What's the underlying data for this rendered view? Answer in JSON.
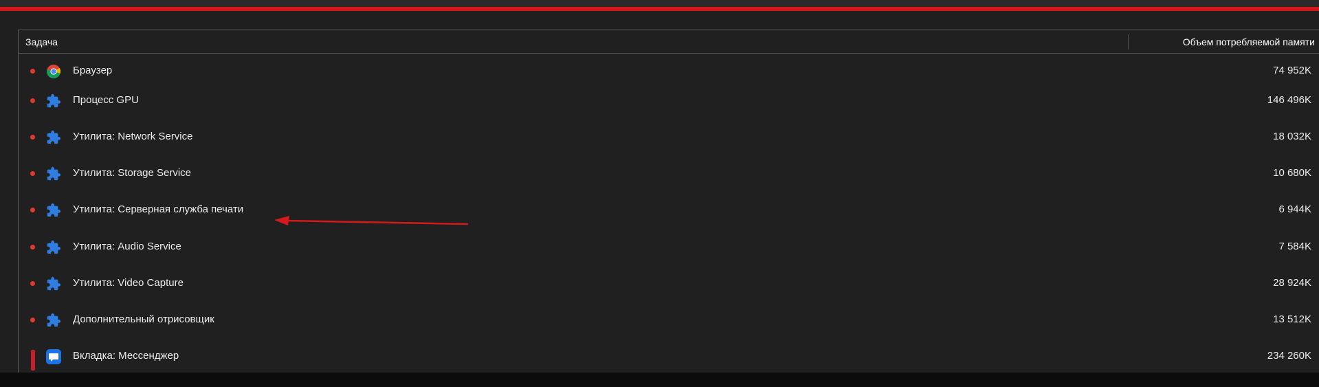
{
  "table": {
    "headers": {
      "task": "Задача",
      "memory": "Объем потребляемой памяти"
    },
    "rows": [
      {
        "icon": "chrome-icon",
        "name": "Браузер",
        "memory": "74 952K"
      },
      {
        "icon": "extension-puzzle-icon",
        "name": "Процесс GPU",
        "memory": "146 496K"
      },
      {
        "icon": "extension-puzzle-icon",
        "name": "Утилита: Network Service",
        "memory": "18 032K"
      },
      {
        "icon": "extension-puzzle-icon",
        "name": "Утилита: Storage Service",
        "memory": "10 680K"
      },
      {
        "icon": "extension-puzzle-icon",
        "name": "Утилита: Серверная служба печати",
        "memory": "6 944K"
      },
      {
        "icon": "extension-puzzle-icon",
        "name": "Утилита: Audio Service",
        "memory": "7 584K"
      },
      {
        "icon": "extension-puzzle-icon",
        "name": "Утилита: Video Capture",
        "memory": "28 924K"
      },
      {
        "icon": "extension-puzzle-icon",
        "name": "Дополнительный отрисовщик",
        "memory": "13 512K"
      },
      {
        "icon": "messenger-chat-icon",
        "name": "Вкладка: Мессенджер",
        "memory": "234 260K"
      }
    ]
  },
  "colors": {
    "accent_red": "#d4161c",
    "bullet_red": "#e03a2f",
    "puzzle_blue": "#2f7de1",
    "annotation_red": "#d41a1a"
  },
  "annotation": {
    "type": "arrow",
    "points_to_row": 4
  }
}
